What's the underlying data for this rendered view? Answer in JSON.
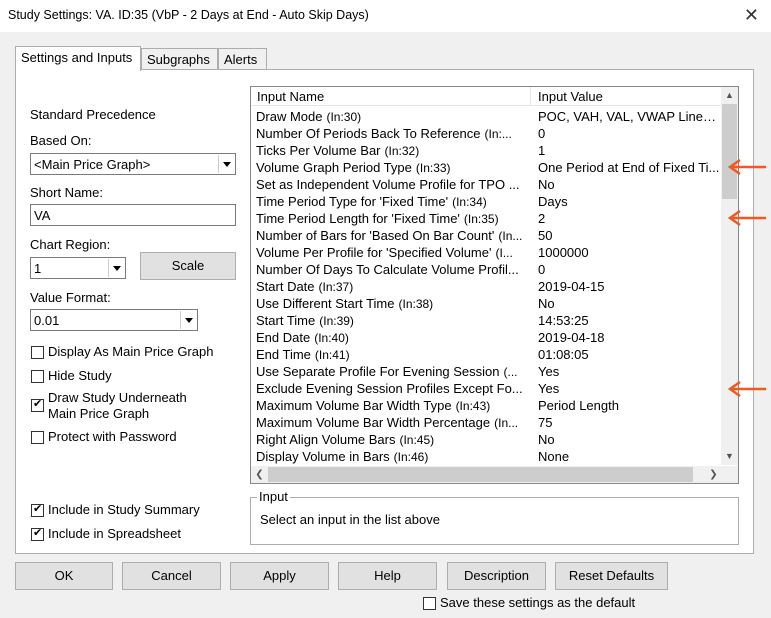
{
  "window": {
    "title": "Study Settings: VA. ID:35 (VbP - 2 Days at End - Auto Skip Days)"
  },
  "tabs": [
    "Settings and Inputs",
    "Subgraphs",
    "Alerts"
  ],
  "left": {
    "standard_precedence": "Standard Precedence",
    "based_on_label": "Based On:",
    "based_on_value": "<Main Price Graph>",
    "short_name_label": "Short Name:",
    "short_name_value": "VA",
    "chart_region_label": "Chart Region:",
    "chart_region_value": "1",
    "scale_button": "Scale",
    "value_format_label": "Value Format:",
    "value_format_value": "0.01",
    "checkboxes": [
      {
        "label": "Display As Main Price Graph",
        "checked": false
      },
      {
        "label": "Hide Study",
        "checked": false
      },
      {
        "label": "Draw Study Underneath",
        "label2": "Main Price Graph",
        "checked": true
      },
      {
        "label": "Protect with Password",
        "checked": false
      }
    ],
    "bottom_checkboxes": [
      {
        "label": "Include in Study Summary",
        "checked": true
      },
      {
        "label": "Include in Spreadsheet",
        "checked": true
      }
    ]
  },
  "inputs": {
    "col_name": "Input Name",
    "col_value": "Input Value",
    "rows": [
      {
        "name": "Draw Mode",
        "id": "(In:30)",
        "value": "POC, VAH, VAL, VWAP Lines ..."
      },
      {
        "name": "Number Of Periods Back To Reference",
        "id": "(In:...",
        "value": "0"
      },
      {
        "name": "Ticks Per Volume Bar",
        "id": "(In:32)",
        "value": "1"
      },
      {
        "name": "Volume Graph Period Type",
        "id": "(In:33)",
        "value": "One Period at End of Fixed Ti..."
      },
      {
        "name": "Set as Independent Volume Profile for TPO ...",
        "id": "",
        "value": "No"
      },
      {
        "name": "Time Period Type for 'Fixed Time'",
        "id": "(In:34)",
        "value": "Days"
      },
      {
        "name": "Time Period Length for 'Fixed Time'",
        "id": "(In:35)",
        "value": "2"
      },
      {
        "name": "Number of Bars for 'Based On Bar Count'",
        "id": "(In...",
        "value": "50"
      },
      {
        "name": "Volume Per Profile for 'Specified Volume'",
        "id": "(I...",
        "value": "1000000"
      },
      {
        "name": "Number Of Days To Calculate Volume Profil...",
        "id": "",
        "value": "0"
      },
      {
        "name": "Start Date",
        "id": "(In:37)",
        "value": "2019-04-15"
      },
      {
        "name": "Use Different Start Time",
        "id": "(In:38)",
        "value": "No"
      },
      {
        "name": "Start Time",
        "id": "(In:39)",
        "value": "14:53:25"
      },
      {
        "name": "End Date",
        "id": "(In:40)",
        "value": "2019-04-18"
      },
      {
        "name": "End Time",
        "id": "(In:41)",
        "value": "01:08:05"
      },
      {
        "name": "Use Separate Profile For Evening Session",
        "id": "(...",
        "value": "Yes"
      },
      {
        "name": "Exclude Evening Session Profiles Except Fo...",
        "id": "",
        "value": "Yes"
      },
      {
        "name": "Maximum Volume Bar Width Type",
        "id": "(In:43)",
        "value": "Period Length"
      },
      {
        "name": "Maximum Volume Bar Width Percentage",
        "id": "(In...",
        "value": "75"
      },
      {
        "name": "Right Align Volume Bars",
        "id": "(In:45)",
        "value": "No"
      },
      {
        "name": "Display Volume in Bars",
        "id": "(In:46)",
        "value": "None"
      }
    ]
  },
  "input_group": {
    "label": "Input",
    "text": "Select an input in the list above"
  },
  "buttons": [
    "OK",
    "Cancel",
    "Apply",
    "Help",
    "Description",
    "Reset Defaults"
  ],
  "save_default": {
    "label": "Save these settings as the default",
    "checked": false
  },
  "annotation_color": "#f05a1e"
}
